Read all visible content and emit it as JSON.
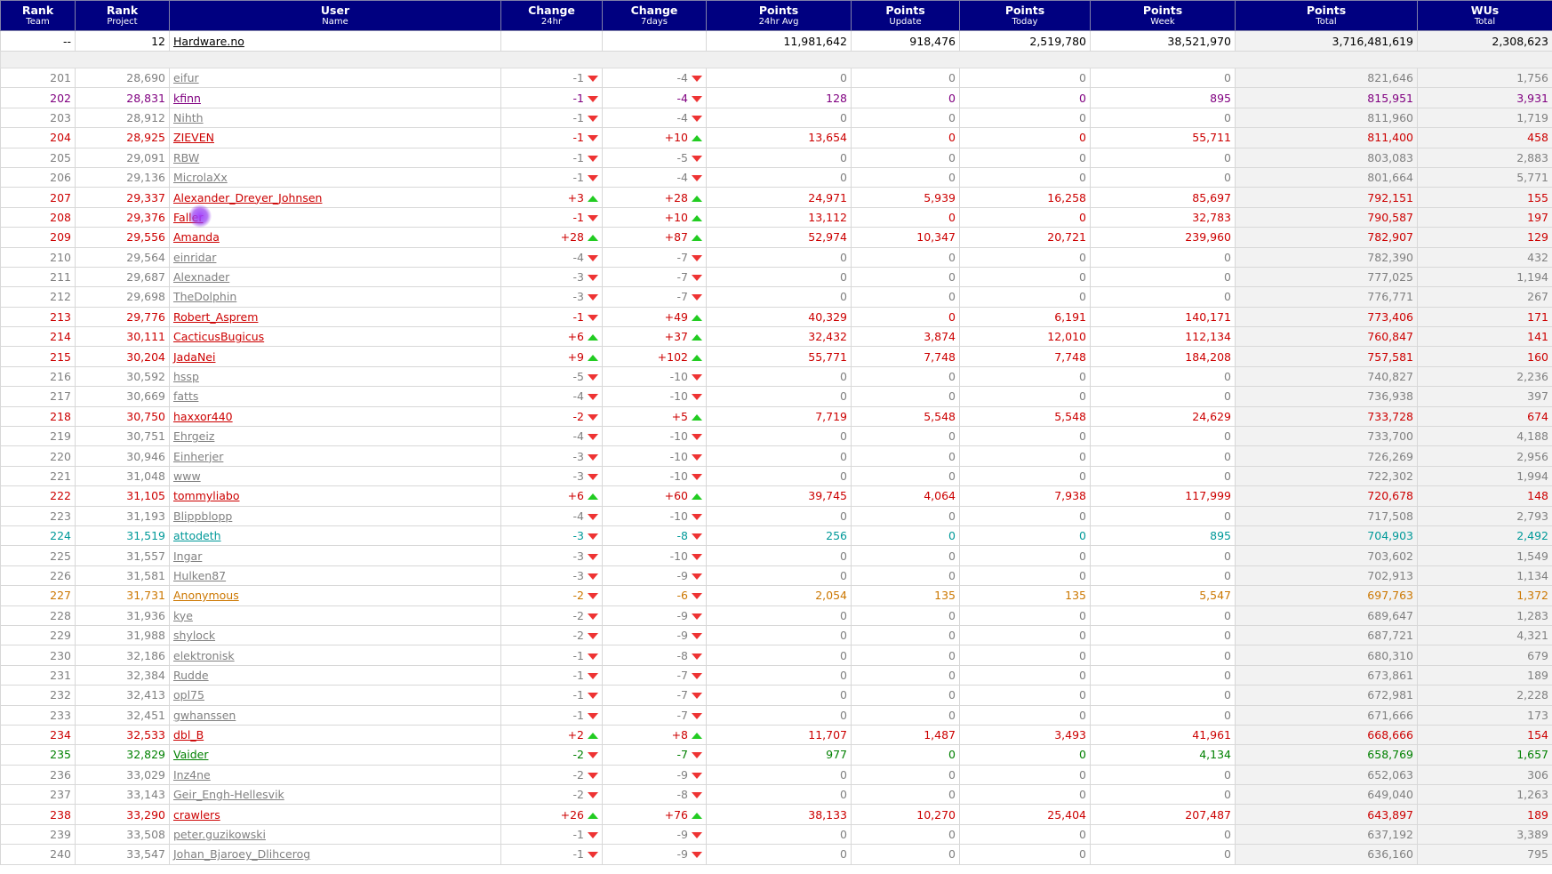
{
  "colors": {
    "header_bg": "#000080",
    "red": "#cc0000",
    "gray": "#808080",
    "purple": "#800080",
    "teal": "#009999",
    "orange": "#cc7700",
    "green": "#008000",
    "up": "#22cc22",
    "down": "#ee3333"
  },
  "columns": [
    {
      "label": "Rank",
      "sub": "Team"
    },
    {
      "label": "Rank",
      "sub": "Project"
    },
    {
      "label": "User",
      "sub": "Name"
    },
    {
      "label": "Change",
      "sub": "24hr"
    },
    {
      "label": "Change",
      "sub": "7days"
    },
    {
      "label": "Points",
      "sub": "24hr Avg"
    },
    {
      "label": "Points",
      "sub": "Update"
    },
    {
      "label": "Points",
      "sub": "Today"
    },
    {
      "label": "Points",
      "sub": "Week"
    },
    {
      "label": "Points",
      "sub": "Total"
    },
    {
      "label": "WUs",
      "sub": "Total"
    }
  ],
  "team": {
    "rank_team": "--",
    "rank_project": "12",
    "name": "Hardware.no",
    "avg": "11,981,642",
    "update": "918,476",
    "today": "2,519,780",
    "week": "38,521,970",
    "total": "3,716,481,619",
    "wus": "2,308,623"
  },
  "rows": [
    {
      "r": "201",
      "p": "28,690",
      "n": "eifur",
      "c1": "-1",
      "d1": "down",
      "c7": "-4",
      "d7": "down",
      "avg": "0",
      "upd": "0",
      "tod": "0",
      "wk": "0",
      "tot": "821,646",
      "wu": "1,756",
      "color": "gray"
    },
    {
      "r": "202",
      "p": "28,831",
      "n": "kfinn",
      "c1": "-1",
      "d1": "down",
      "c7": "-4",
      "d7": "down",
      "avg": "128",
      "upd": "0",
      "tod": "0",
      "wk": "895",
      "tot": "815,951",
      "wu": "3,931",
      "color": "purple"
    },
    {
      "r": "203",
      "p": "28,912",
      "n": "Nihth",
      "c1": "-1",
      "d1": "down",
      "c7": "-4",
      "d7": "down",
      "avg": "0",
      "upd": "0",
      "tod": "0",
      "wk": "0",
      "tot": "811,960",
      "wu": "1,719",
      "color": "gray"
    },
    {
      "r": "204",
      "p": "28,925",
      "n": "ZIEVEN",
      "c1": "-1",
      "d1": "down",
      "c7": "+10",
      "d7": "up",
      "avg": "13,654",
      "upd": "0",
      "tod": "0",
      "wk": "55,711",
      "tot": "811,400",
      "wu": "458",
      "color": "red"
    },
    {
      "r": "205",
      "p": "29,091",
      "n": "RBW",
      "c1": "-1",
      "d1": "down",
      "c7": "-5",
      "d7": "down",
      "avg": "0",
      "upd": "0",
      "tod": "0",
      "wk": "0",
      "tot": "803,083",
      "wu": "2,883",
      "color": "gray"
    },
    {
      "r": "206",
      "p": "29,136",
      "n": "MicrolaXx",
      "c1": "-1",
      "d1": "down",
      "c7": "-4",
      "d7": "down",
      "avg": "0",
      "upd": "0",
      "tod": "0",
      "wk": "0",
      "tot": "801,664",
      "wu": "5,771",
      "color": "gray"
    },
    {
      "r": "207",
      "p": "29,337",
      "n": "Alexander_Dreyer_Johnsen",
      "c1": "+3",
      "d1": "up",
      "c7": "+28",
      "d7": "up",
      "avg": "24,971",
      "upd": "5,939",
      "tod": "16,258",
      "wk": "85,697",
      "tot": "792,151",
      "wu": "155",
      "color": "red"
    },
    {
      "r": "208",
      "p": "29,376",
      "n": "Faller",
      "c1": "-1",
      "d1": "down",
      "c7": "+10",
      "d7": "up",
      "avg": "13,112",
      "upd": "0",
      "tod": "0",
      "wk": "32,783",
      "tot": "790,587",
      "wu": "197",
      "color": "red"
    },
    {
      "r": "209",
      "p": "29,556",
      "n": "Amanda",
      "c1": "+28",
      "d1": "up",
      "c7": "+87",
      "d7": "up",
      "avg": "52,974",
      "upd": "10,347",
      "tod": "20,721",
      "wk": "239,960",
      "tot": "782,907",
      "wu": "129",
      "color": "red"
    },
    {
      "r": "210",
      "p": "29,564",
      "n": "einridar",
      "c1": "-4",
      "d1": "down",
      "c7": "-7",
      "d7": "down",
      "avg": "0",
      "upd": "0",
      "tod": "0",
      "wk": "0",
      "tot": "782,390",
      "wu": "432",
      "color": "gray"
    },
    {
      "r": "211",
      "p": "29,687",
      "n": "Alexnader",
      "c1": "-3",
      "d1": "down",
      "c7": "-7",
      "d7": "down",
      "avg": "0",
      "upd": "0",
      "tod": "0",
      "wk": "0",
      "tot": "777,025",
      "wu": "1,194",
      "color": "gray"
    },
    {
      "r": "212",
      "p": "29,698",
      "n": "TheDolphin",
      "c1": "-3",
      "d1": "down",
      "c7": "-7",
      "d7": "down",
      "avg": "0",
      "upd": "0",
      "tod": "0",
      "wk": "0",
      "tot": "776,771",
      "wu": "267",
      "color": "gray"
    },
    {
      "r": "213",
      "p": "29,776",
      "n": "Robert_Asprem",
      "c1": "-1",
      "d1": "down",
      "c7": "+49",
      "d7": "up",
      "avg": "40,329",
      "upd": "0",
      "tod": "6,191",
      "wk": "140,171",
      "tot": "773,406",
      "wu": "171",
      "color": "red"
    },
    {
      "r": "214",
      "p": "30,111",
      "n": "CacticusBugicus",
      "c1": "+6",
      "d1": "up",
      "c7": "+37",
      "d7": "up",
      "avg": "32,432",
      "upd": "3,874",
      "tod": "12,010",
      "wk": "112,134",
      "tot": "760,847",
      "wu": "141",
      "color": "red"
    },
    {
      "r": "215",
      "p": "30,204",
      "n": "JadaNei",
      "c1": "+9",
      "d1": "up",
      "c7": "+102",
      "d7": "up",
      "avg": "55,771",
      "upd": "7,748",
      "tod": "7,748",
      "wk": "184,208",
      "tot": "757,581",
      "wu": "160",
      "color": "red"
    },
    {
      "r": "216",
      "p": "30,592",
      "n": "hssp",
      "c1": "-5",
      "d1": "down",
      "c7": "-10",
      "d7": "down",
      "avg": "0",
      "upd": "0",
      "tod": "0",
      "wk": "0",
      "tot": "740,827",
      "wu": "2,236",
      "color": "gray"
    },
    {
      "r": "217",
      "p": "30,669",
      "n": "fatts",
      "c1": "-4",
      "d1": "down",
      "c7": "-10",
      "d7": "down",
      "avg": "0",
      "upd": "0",
      "tod": "0",
      "wk": "0",
      "tot": "736,938",
      "wu": "397",
      "color": "gray"
    },
    {
      "r": "218",
      "p": "30,750",
      "n": "haxxor440",
      "c1": "-2",
      "d1": "down",
      "c7": "+5",
      "d7": "up",
      "avg": "7,719",
      "upd": "5,548",
      "tod": "5,548",
      "wk": "24,629",
      "tot": "733,728",
      "wu": "674",
      "color": "red"
    },
    {
      "r": "219",
      "p": "30,751",
      "n": "Ehrgeiz",
      "c1": "-4",
      "d1": "down",
      "c7": "-10",
      "d7": "down",
      "avg": "0",
      "upd": "0",
      "tod": "0",
      "wk": "0",
      "tot": "733,700",
      "wu": "4,188",
      "color": "gray"
    },
    {
      "r": "220",
      "p": "30,946",
      "n": "Einherjer",
      "c1": "-3",
      "d1": "down",
      "c7": "-10",
      "d7": "down",
      "avg": "0",
      "upd": "0",
      "tod": "0",
      "wk": "0",
      "tot": "726,269",
      "wu": "2,956",
      "color": "gray"
    },
    {
      "r": "221",
      "p": "31,048",
      "n": "www",
      "c1": "-3",
      "d1": "down",
      "c7": "-10",
      "d7": "down",
      "avg": "0",
      "upd": "0",
      "tod": "0",
      "wk": "0",
      "tot": "722,302",
      "wu": "1,994",
      "color": "gray"
    },
    {
      "r": "222",
      "p": "31,105",
      "n": "tommyliabo",
      "c1": "+6",
      "d1": "up",
      "c7": "+60",
      "d7": "up",
      "avg": "39,745",
      "upd": "4,064",
      "tod": "7,938",
      "wk": "117,999",
      "tot": "720,678",
      "wu": "148",
      "color": "red"
    },
    {
      "r": "223",
      "p": "31,193",
      "n": "Blippblopp",
      "c1": "-4",
      "d1": "down",
      "c7": "-10",
      "d7": "down",
      "avg": "0",
      "upd": "0",
      "tod": "0",
      "wk": "0",
      "tot": "717,508",
      "wu": "2,793",
      "color": "gray"
    },
    {
      "r": "224",
      "p": "31,519",
      "n": "attodeth",
      "c1": "-3",
      "d1": "down",
      "c7": "-8",
      "d7": "down",
      "avg": "256",
      "upd": "0",
      "tod": "0",
      "wk": "895",
      "tot": "704,903",
      "wu": "2,492",
      "color": "teal"
    },
    {
      "r": "225",
      "p": "31,557",
      "n": "Ingar",
      "c1": "-3",
      "d1": "down",
      "c7": "-10",
      "d7": "down",
      "avg": "0",
      "upd": "0",
      "tod": "0",
      "wk": "0",
      "tot": "703,602",
      "wu": "1,549",
      "color": "gray"
    },
    {
      "r": "226",
      "p": "31,581",
      "n": "Hulken87",
      "c1": "-3",
      "d1": "down",
      "c7": "-9",
      "d7": "down",
      "avg": "0",
      "upd": "0",
      "tod": "0",
      "wk": "0",
      "tot": "702,913",
      "wu": "1,134",
      "color": "gray"
    },
    {
      "r": "227",
      "p": "31,731",
      "n": "Anonymous",
      "c1": "-2",
      "d1": "down",
      "c7": "-6",
      "d7": "down",
      "avg": "2,054",
      "upd": "135",
      "tod": "135",
      "wk": "5,547",
      "tot": "697,763",
      "wu": "1,372",
      "color": "orange"
    },
    {
      "r": "228",
      "p": "31,936",
      "n": "kye",
      "c1": "-2",
      "d1": "down",
      "c7": "-9",
      "d7": "down",
      "avg": "0",
      "upd": "0",
      "tod": "0",
      "wk": "0",
      "tot": "689,647",
      "wu": "1,283",
      "color": "gray"
    },
    {
      "r": "229",
      "p": "31,988",
      "n": "shylock",
      "c1": "-2",
      "d1": "down",
      "c7": "-9",
      "d7": "down",
      "avg": "0",
      "upd": "0",
      "tod": "0",
      "wk": "0",
      "tot": "687,721",
      "wu": "4,321",
      "color": "gray"
    },
    {
      "r": "230",
      "p": "32,186",
      "n": "elektronisk",
      "c1": "-1",
      "d1": "down",
      "c7": "-8",
      "d7": "down",
      "avg": "0",
      "upd": "0",
      "tod": "0",
      "wk": "0",
      "tot": "680,310",
      "wu": "679",
      "color": "gray"
    },
    {
      "r": "231",
      "p": "32,384",
      "n": "Rudde",
      "c1": "-1",
      "d1": "down",
      "c7": "-7",
      "d7": "down",
      "avg": "0",
      "upd": "0",
      "tod": "0",
      "wk": "0",
      "tot": "673,861",
      "wu": "189",
      "color": "gray"
    },
    {
      "r": "232",
      "p": "32,413",
      "n": "opl75",
      "c1": "-1",
      "d1": "down",
      "c7": "-7",
      "d7": "down",
      "avg": "0",
      "upd": "0",
      "tod": "0",
      "wk": "0",
      "tot": "672,981",
      "wu": "2,228",
      "color": "gray"
    },
    {
      "r": "233",
      "p": "32,451",
      "n": "gwhanssen",
      "c1": "-1",
      "d1": "down",
      "c7": "-7",
      "d7": "down",
      "avg": "0",
      "upd": "0",
      "tod": "0",
      "wk": "0",
      "tot": "671,666",
      "wu": "173",
      "color": "gray"
    },
    {
      "r": "234",
      "p": "32,533",
      "n": "dbl_B",
      "c1": "+2",
      "d1": "up",
      "c7": "+8",
      "d7": "up",
      "avg": "11,707",
      "upd": "1,487",
      "tod": "3,493",
      "wk": "41,961",
      "tot": "668,666",
      "wu": "154",
      "color": "red"
    },
    {
      "r": "235",
      "p": "32,829",
      "n": "Vaider",
      "c1": "-2",
      "d1": "down",
      "c7": "-7",
      "d7": "down",
      "avg": "977",
      "upd": "0",
      "tod": "0",
      "wk": "4,134",
      "tot": "658,769",
      "wu": "1,657",
      "color": "green"
    },
    {
      "r": "236",
      "p": "33,029",
      "n": "Inz4ne",
      "c1": "-2",
      "d1": "down",
      "c7": "-9",
      "d7": "down",
      "avg": "0",
      "upd": "0",
      "tod": "0",
      "wk": "0",
      "tot": "652,063",
      "wu": "306",
      "color": "gray"
    },
    {
      "r": "237",
      "p": "33,143",
      "n": "Geir_Engh-Hellesvik",
      "c1": "-2",
      "d1": "down",
      "c7": "-8",
      "d7": "down",
      "avg": "0",
      "upd": "0",
      "tod": "0",
      "wk": "0",
      "tot": "649,040",
      "wu": "1,263",
      "color": "gray"
    },
    {
      "r": "238",
      "p": "33,290",
      "n": "crawlers",
      "c1": "+26",
      "d1": "up",
      "c7": "+76",
      "d7": "up",
      "avg": "38,133",
      "upd": "10,270",
      "tod": "25,404",
      "wk": "207,487",
      "tot": "643,897",
      "wu": "189",
      "color": "red"
    },
    {
      "r": "239",
      "p": "33,508",
      "n": "peter.guzikowski",
      "c1": "-1",
      "d1": "down",
      "c7": "-9",
      "d7": "down",
      "avg": "0",
      "upd": "0",
      "tod": "0",
      "wk": "0",
      "tot": "637,192",
      "wu": "3,389",
      "color": "gray"
    },
    {
      "r": "240",
      "p": "33,547",
      "n": "Johan_Bjaroey_Dlihcerog",
      "c1": "-1",
      "d1": "down",
      "c7": "-9",
      "d7": "down",
      "avg": "0",
      "upd": "0",
      "tod": "0",
      "wk": "0",
      "tot": "636,160",
      "wu": "795",
      "color": "gray"
    }
  ]
}
